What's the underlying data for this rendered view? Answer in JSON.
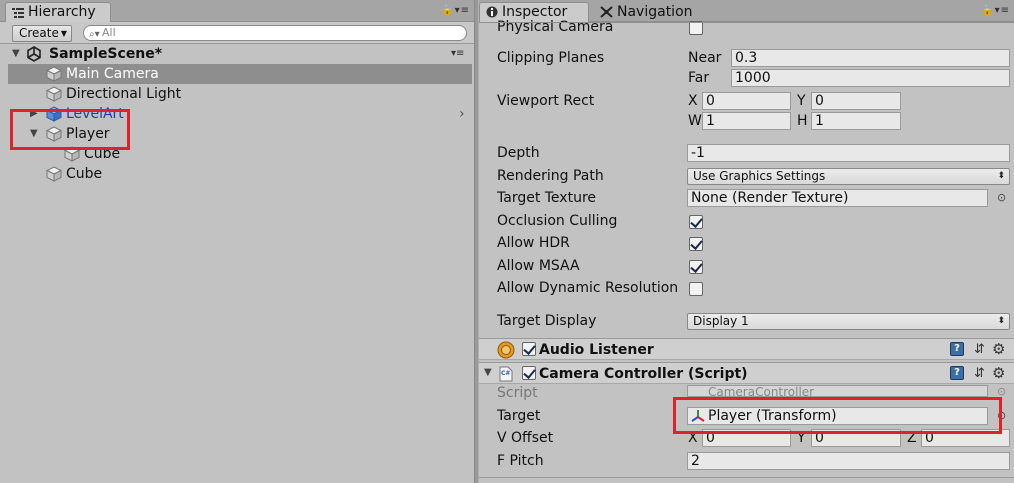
{
  "hierarchy": {
    "tab_label": "Hierarchy",
    "create_label": "Create",
    "search_placeholder": "All",
    "scene_name": "SampleScene*",
    "items": [
      {
        "label": "Main Camera"
      },
      {
        "label": "Directional Light"
      },
      {
        "label": "LevelArt"
      },
      {
        "label": "Player"
      },
      {
        "label": "Cube"
      },
      {
        "label": "Cube"
      }
    ]
  },
  "inspector": {
    "tab_label": "Inspector",
    "nav_tab_label": "Navigation",
    "physical_camera_label": "Physical Camera",
    "clipping_planes_label": "Clipping Planes",
    "near_label": "Near",
    "near_value": "0.3",
    "far_label": "Far",
    "far_value": "1000",
    "viewport_rect_label": "Viewport Rect",
    "x_label": "X",
    "x_value": "0",
    "y_label": "Y",
    "y_value": "0",
    "w_label": "W",
    "w_value": "1",
    "h_label": "H",
    "h_value": "1",
    "depth_label": "Depth",
    "depth_value": "-1",
    "rendering_path_label": "Rendering Path",
    "rendering_path_value": "Use Graphics Settings",
    "target_texture_label": "Target Texture",
    "target_texture_value": "None (Render Texture)",
    "occlusion_culling_label": "Occlusion Culling",
    "allow_hdr_label": "Allow HDR",
    "allow_msaa_label": "Allow MSAA",
    "allow_dynres_label": "Allow Dynamic Resolution",
    "target_display_label": "Target Display",
    "target_display_value": "Display 1",
    "audio_listener_title": "Audio Listener",
    "camera_controller_title": "Camera Controller (Script)",
    "script_label": "Script",
    "script_value": "CameraController",
    "target_label": "Target",
    "target_value": "Player (Transform)",
    "voffset_label": "V Offset",
    "voffset_x_label": "X",
    "voffset_x": "0",
    "voffset_y_label": "Y",
    "voffset_y": "0",
    "voffset_z_label": "Z",
    "voffset_z": "0",
    "fpitch_label": "F Pitch",
    "fpitch_value": "2",
    "script_icon_text": "C#"
  }
}
